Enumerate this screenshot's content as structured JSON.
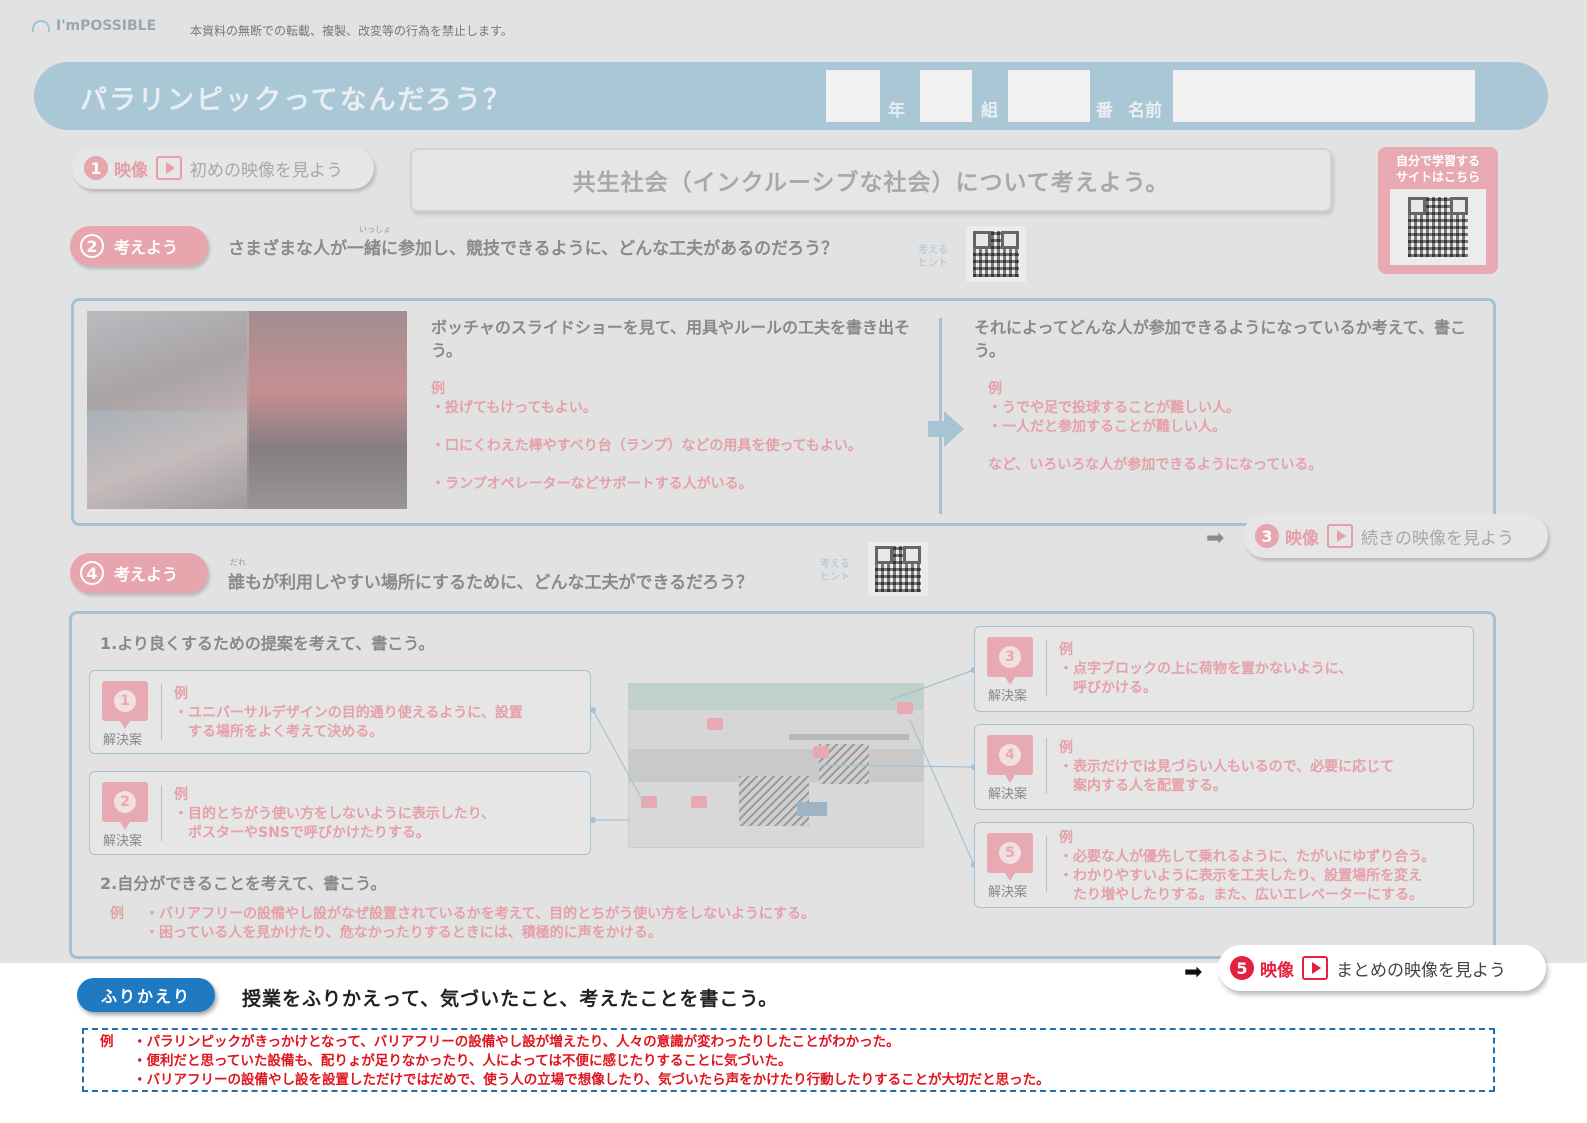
{
  "header": {
    "logo": "I'mPOSSIBLE",
    "copyright": "本資料の無断での転載、複製、改変等の行為を禁止します。",
    "title": "パラリンピックってなんだろう？",
    "grade_label": "年",
    "class_label": "組",
    "number_label": "番",
    "name_label": "名前"
  },
  "step1": {
    "num": "1",
    "kind": "映像",
    "text": "初めの映像を見よう"
  },
  "theme": "共生社会（インクルーシブな社会）について考えよう。",
  "self_study": {
    "line1": "自分で学習する",
    "line2": "サイトはこちら"
  },
  "step2": {
    "num": "2",
    "label": "考えよう",
    "ruby": "いっしょ",
    "question": "さまざまな人が一緒に参加し、競技できるように、どんな工夫があるのだろう？",
    "hint_line1": "考える",
    "hint_line2": "ヒント",
    "left_heading": "ボッチャのスライドショーを見て、用具やルールの工夫を書き出そう。",
    "left_example_label": "例",
    "left_examples": [
      "・投げてもけってもよい。",
      "・口にくわえた棒やすべり台（ランプ）などの用具を使ってもよい。",
      "・ランプオペレーターなどサポートする人がいる。"
    ],
    "right_heading": "それによってどんな人が参加できるようになっているか考えて、書こう。",
    "right_example_label": "例",
    "right_examples": [
      "・うでや足で投球することが難しい人。",
      "・一人だと参加することが難しい人。",
      "など、いろいろな人が参加できるようになっている。"
    ]
  },
  "step3": {
    "num": "3",
    "kind": "映像",
    "text": "続きの映像を見よう"
  },
  "step4": {
    "num": "4",
    "label": "考えよう",
    "ruby": "だれ",
    "question": "誰もが利用しやすい場所にするために、どんな工夫ができるだろう？",
    "hint_line1": "考える",
    "hint_line2": "ヒント",
    "section1_heading": "1.より良くするための提案を考えて、書こう。",
    "solution_label": "解決案",
    "example_label": "例",
    "solutions": [
      {
        "num": "1",
        "lines": [
          "・ユニバーサルデザインの目的通り使えるように、設置",
          "　する場所をよく考えて決める。"
        ]
      },
      {
        "num": "2",
        "lines": [
          "・目的とちがう使い方をしないように表示したり、",
          "　ポスターやSNSで呼びかけたりする。"
        ]
      },
      {
        "num": "3",
        "lines": [
          "・点字ブロックの上に荷物を置かないように、",
          "　呼びかける。"
        ]
      },
      {
        "num": "4",
        "lines": [
          "・表示だけでは見づらい人もいるので、必要に応じて",
          "　案内する人を配置する。"
        ]
      },
      {
        "num": "5",
        "lines": [
          "・必要な人が優先して乗れるように、たがいにゆずり合う。",
          "・わかりやすいように表示を工夫したり、設置場所を変え",
          "　たり増やしたりする。また、広いエレベーターにする。"
        ]
      }
    ],
    "section2_heading": "2.自分ができることを考えて、書こう。",
    "section2_example_label": "例",
    "section2_examples": [
      "・バリアフリーの設備やし設がなぜ設置されているかを考えて、目的とちがう使い方をしないようにする。",
      "・困っている人を見かけたり、危なかったりするときには、積極的に声をかける。"
    ]
  },
  "step5": {
    "num": "5",
    "kind": "映像",
    "text": "まとめの映像を見よう"
  },
  "review": {
    "label": "ふりかえり",
    "question": "授業をふりかえって、気づいたこと、考えたことを書こう。",
    "example_label": "例",
    "examples": [
      "・パラリンピックがきっかけとなって、バリアフリーの設備やし設が増えたり、人々の意識が変わったりしたことがわかった。",
      "・便利だと思っていた設備も、配りょが足りなかったり、人によっては不便に感じたりすることに気づいた。",
      "・バリアフリーの設備やし設を設置しただけではだめで、使う人の立場で想像したり、気づいたら声をかけたり行動したりすることが大切だと思った。"
    ]
  },
  "colors": {
    "accent_pink": "#e7a5ad",
    "accent_blue": "#a4c2d4",
    "review_blue": "#1f7ac2",
    "example_red": "#e0141e",
    "step5_red": "#e4223e"
  }
}
